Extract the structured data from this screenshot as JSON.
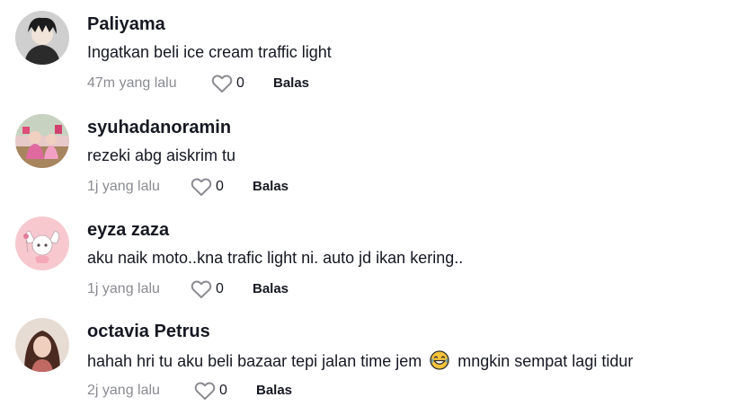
{
  "comments": [
    {
      "username": "Paliyama",
      "text": "Ingatkan beli ice cream traffic light",
      "time": "47m yang lalu",
      "likes": "0",
      "reply_label": "Balas"
    },
    {
      "username": "syuhadanoramin",
      "text": "rezeki abg aiskrim tu",
      "time": "1j yang lalu",
      "likes": "0",
      "reply_label": "Balas"
    },
    {
      "username": "eyza zaza",
      "text": "aku naik moto..kna trafic light ni. auto jd ikan kering..",
      "time": "1j yang lalu",
      "likes": "0",
      "reply_label": "Balas"
    },
    {
      "username": "octavia Petrus",
      "text_before_emoji": "hahah hri tu aku beli bazaar tepi jalan time jem",
      "text_after_emoji": "mngkin sempat lagi tidur",
      "emoji": "laughing-emoji",
      "time": "2j yang lalu",
      "likes": "0",
      "reply_label": "Balas"
    }
  ],
  "icons": {
    "like": "heart-outline-icon"
  },
  "colors": {
    "text": "#161823",
    "muted": "#8a8b91"
  }
}
